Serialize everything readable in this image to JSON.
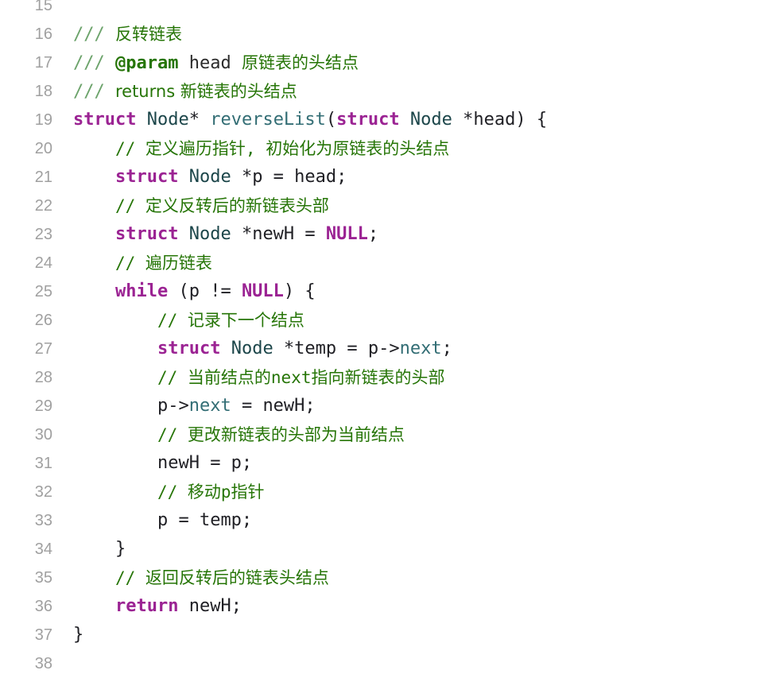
{
  "lines": [
    {
      "num": "15",
      "tokens": []
    },
    {
      "num": "16",
      "tokens": [
        {
          "t": "/// ",
          "c": "doc-slash"
        },
        {
          "t": "反转链表",
          "c": "doc-text"
        }
      ]
    },
    {
      "num": "17",
      "tokens": [
        {
          "t": "/// ",
          "c": "doc-slash"
        },
        {
          "t": "@param",
          "c": "doc-tag"
        },
        {
          "t": " head ",
          "c": "doc-mono"
        },
        {
          "t": "原链表的头结点",
          "c": "doc-text"
        }
      ]
    },
    {
      "num": "18",
      "tokens": [
        {
          "t": "/// ",
          "c": "doc-slash"
        },
        {
          "t": "returns 新链表的头结点",
          "c": "doc-text"
        }
      ]
    },
    {
      "num": "19",
      "tokens": [
        {
          "t": "struct",
          "c": "kw"
        },
        {
          "t": " ",
          "c": "plain"
        },
        {
          "t": "Node",
          "c": "type"
        },
        {
          "t": "* ",
          "c": "plain"
        },
        {
          "t": "reverseList",
          "c": "fn"
        },
        {
          "t": "(",
          "c": "plain"
        },
        {
          "t": "struct",
          "c": "kw"
        },
        {
          "t": " ",
          "c": "plain"
        },
        {
          "t": "Node",
          "c": "type"
        },
        {
          "t": " *head) {",
          "c": "plain"
        }
      ]
    },
    {
      "num": "20",
      "tokens": [
        {
          "t": "    ",
          "c": "plain"
        },
        {
          "t": "// 定义遍历指针, 初始化为原链表的头结点",
          "c": "cm"
        }
      ]
    },
    {
      "num": "21",
      "tokens": [
        {
          "t": "    ",
          "c": "plain"
        },
        {
          "t": "struct",
          "c": "kw"
        },
        {
          "t": " ",
          "c": "plain"
        },
        {
          "t": "Node",
          "c": "type"
        },
        {
          "t": " *p = head;",
          "c": "plain"
        }
      ]
    },
    {
      "num": "22",
      "tokens": [
        {
          "t": "    ",
          "c": "plain"
        },
        {
          "t": "// 定义反转后的新链表头部",
          "c": "cm"
        }
      ]
    },
    {
      "num": "23",
      "tokens": [
        {
          "t": "    ",
          "c": "plain"
        },
        {
          "t": "struct",
          "c": "kw"
        },
        {
          "t": " ",
          "c": "plain"
        },
        {
          "t": "Node",
          "c": "type"
        },
        {
          "t": " *newH = ",
          "c": "plain"
        },
        {
          "t": "NULL",
          "c": "kw"
        },
        {
          "t": ";",
          "c": "plain"
        }
      ]
    },
    {
      "num": "24",
      "tokens": [
        {
          "t": "    ",
          "c": "plain"
        },
        {
          "t": "// 遍历链表",
          "c": "cm"
        }
      ]
    },
    {
      "num": "25",
      "tokens": [
        {
          "t": "    ",
          "c": "plain"
        },
        {
          "t": "while",
          "c": "kw"
        },
        {
          "t": " (p != ",
          "c": "plain"
        },
        {
          "t": "NULL",
          "c": "kw"
        },
        {
          "t": ") {",
          "c": "plain"
        }
      ]
    },
    {
      "num": "26",
      "tokens": [
        {
          "t": "        ",
          "c": "plain"
        },
        {
          "t": "// 记录下一个结点",
          "c": "cm"
        }
      ]
    },
    {
      "num": "27",
      "tokens": [
        {
          "t": "        ",
          "c": "plain"
        },
        {
          "t": "struct",
          "c": "kw"
        },
        {
          "t": " ",
          "c": "plain"
        },
        {
          "t": "Node",
          "c": "type"
        },
        {
          "t": " *temp = p->",
          "c": "plain"
        },
        {
          "t": "next",
          "c": "prop"
        },
        {
          "t": ";",
          "c": "plain"
        }
      ]
    },
    {
      "num": "28",
      "tokens": [
        {
          "t": "        ",
          "c": "plain"
        },
        {
          "t": "// 当前结点的next指向新链表的头部",
          "c": "cm"
        }
      ]
    },
    {
      "num": "29",
      "tokens": [
        {
          "t": "        ",
          "c": "plain"
        },
        {
          "t": "p->",
          "c": "plain"
        },
        {
          "t": "next",
          "c": "prop"
        },
        {
          "t": " = newH;",
          "c": "plain"
        }
      ]
    },
    {
      "num": "30",
      "tokens": [
        {
          "t": "        ",
          "c": "plain"
        },
        {
          "t": "// 更改新链表的头部为当前结点",
          "c": "cm"
        }
      ]
    },
    {
      "num": "31",
      "tokens": [
        {
          "t": "        ",
          "c": "plain"
        },
        {
          "t": "newH = p;",
          "c": "plain"
        }
      ]
    },
    {
      "num": "32",
      "tokens": [
        {
          "t": "        ",
          "c": "plain"
        },
        {
          "t": "// 移动p指针",
          "c": "cm"
        }
      ]
    },
    {
      "num": "33",
      "tokens": [
        {
          "t": "        ",
          "c": "plain"
        },
        {
          "t": "p = temp;",
          "c": "plain"
        }
      ]
    },
    {
      "num": "34",
      "tokens": [
        {
          "t": "    }",
          "c": "plain"
        }
      ]
    },
    {
      "num": "35",
      "tokens": [
        {
          "t": "    ",
          "c": "plain"
        },
        {
          "t": "// 返回反转后的链表头结点",
          "c": "cm"
        }
      ]
    },
    {
      "num": "36",
      "tokens": [
        {
          "t": "    ",
          "c": "plain"
        },
        {
          "t": "return",
          "c": "kw"
        },
        {
          "t": " newH;",
          "c": "plain"
        }
      ]
    },
    {
      "num": "37",
      "tokens": [
        {
          "t": "}",
          "c": "plain"
        }
      ]
    },
    {
      "num": "38",
      "tokens": []
    }
  ]
}
